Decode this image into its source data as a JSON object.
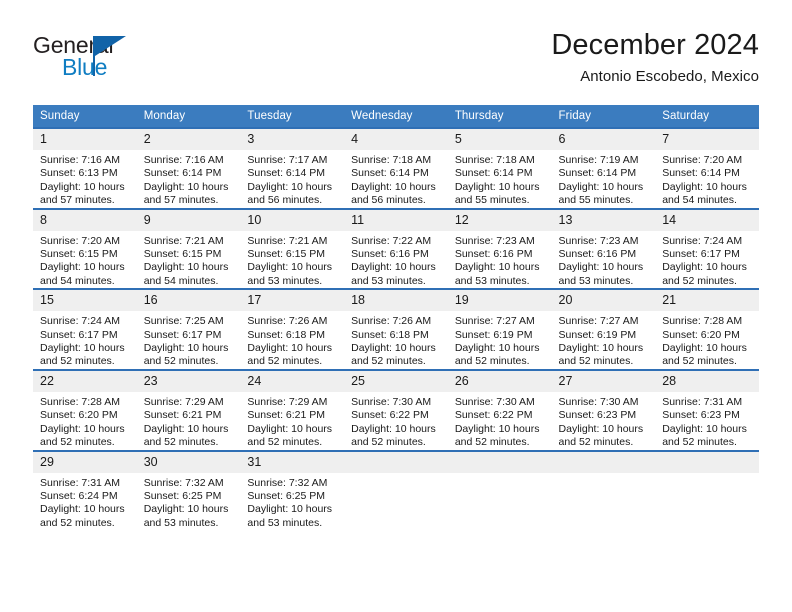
{
  "logo": {
    "word_top": "General",
    "word_bottom": "Blue",
    "accent_color": "#1163a8",
    "text_color": "#231f20"
  },
  "header": {
    "title": "December 2024",
    "subtitle": "Antonio Escobedo, Mexico"
  },
  "colors": {
    "header_row_bg": "#3b7cbf",
    "row_border": "#2f6fb5",
    "daynum_bg": "#efefef",
    "page_bg": "#ffffff",
    "text": "#1a1a1a"
  },
  "weekday_headers": [
    "Sunday",
    "Monday",
    "Tuesday",
    "Wednesday",
    "Thursday",
    "Friday",
    "Saturday"
  ],
  "labels": {
    "sunrise_prefix": "Sunrise:",
    "sunset_prefix": "Sunset:",
    "daylight_prefix": "Daylight:"
  },
  "weeks": [
    [
      {
        "day": "1",
        "sunrise": "Sunrise: 7:16 AM",
        "sunset": "Sunset: 6:13 PM",
        "daylight_1": "Daylight: 10 hours",
        "daylight_2": "and 57 minutes."
      },
      {
        "day": "2",
        "sunrise": "Sunrise: 7:16 AM",
        "sunset": "Sunset: 6:14 PM",
        "daylight_1": "Daylight: 10 hours",
        "daylight_2": "and 57 minutes."
      },
      {
        "day": "3",
        "sunrise": "Sunrise: 7:17 AM",
        "sunset": "Sunset: 6:14 PM",
        "daylight_1": "Daylight: 10 hours",
        "daylight_2": "and 56 minutes."
      },
      {
        "day": "4",
        "sunrise": "Sunrise: 7:18 AM",
        "sunset": "Sunset: 6:14 PM",
        "daylight_1": "Daylight: 10 hours",
        "daylight_2": "and 56 minutes."
      },
      {
        "day": "5",
        "sunrise": "Sunrise: 7:18 AM",
        "sunset": "Sunset: 6:14 PM",
        "daylight_1": "Daylight: 10 hours",
        "daylight_2": "and 55 minutes."
      },
      {
        "day": "6",
        "sunrise": "Sunrise: 7:19 AM",
        "sunset": "Sunset: 6:14 PM",
        "daylight_1": "Daylight: 10 hours",
        "daylight_2": "and 55 minutes."
      },
      {
        "day": "7",
        "sunrise": "Sunrise: 7:20 AM",
        "sunset": "Sunset: 6:14 PM",
        "daylight_1": "Daylight: 10 hours",
        "daylight_2": "and 54 minutes."
      }
    ],
    [
      {
        "day": "8",
        "sunrise": "Sunrise: 7:20 AM",
        "sunset": "Sunset: 6:15 PM",
        "daylight_1": "Daylight: 10 hours",
        "daylight_2": "and 54 minutes."
      },
      {
        "day": "9",
        "sunrise": "Sunrise: 7:21 AM",
        "sunset": "Sunset: 6:15 PM",
        "daylight_1": "Daylight: 10 hours",
        "daylight_2": "and 54 minutes."
      },
      {
        "day": "10",
        "sunrise": "Sunrise: 7:21 AM",
        "sunset": "Sunset: 6:15 PM",
        "daylight_1": "Daylight: 10 hours",
        "daylight_2": "and 53 minutes."
      },
      {
        "day": "11",
        "sunrise": "Sunrise: 7:22 AM",
        "sunset": "Sunset: 6:16 PM",
        "daylight_1": "Daylight: 10 hours",
        "daylight_2": "and 53 minutes."
      },
      {
        "day": "12",
        "sunrise": "Sunrise: 7:23 AM",
        "sunset": "Sunset: 6:16 PM",
        "daylight_1": "Daylight: 10 hours",
        "daylight_2": "and 53 minutes."
      },
      {
        "day": "13",
        "sunrise": "Sunrise: 7:23 AM",
        "sunset": "Sunset: 6:16 PM",
        "daylight_1": "Daylight: 10 hours",
        "daylight_2": "and 53 minutes."
      },
      {
        "day": "14",
        "sunrise": "Sunrise: 7:24 AM",
        "sunset": "Sunset: 6:17 PM",
        "daylight_1": "Daylight: 10 hours",
        "daylight_2": "and 52 minutes."
      }
    ],
    [
      {
        "day": "15",
        "sunrise": "Sunrise: 7:24 AM",
        "sunset": "Sunset: 6:17 PM",
        "daylight_1": "Daylight: 10 hours",
        "daylight_2": "and 52 minutes."
      },
      {
        "day": "16",
        "sunrise": "Sunrise: 7:25 AM",
        "sunset": "Sunset: 6:17 PM",
        "daylight_1": "Daylight: 10 hours",
        "daylight_2": "and 52 minutes."
      },
      {
        "day": "17",
        "sunrise": "Sunrise: 7:26 AM",
        "sunset": "Sunset: 6:18 PM",
        "daylight_1": "Daylight: 10 hours",
        "daylight_2": "and 52 minutes."
      },
      {
        "day": "18",
        "sunrise": "Sunrise: 7:26 AM",
        "sunset": "Sunset: 6:18 PM",
        "daylight_1": "Daylight: 10 hours",
        "daylight_2": "and 52 minutes."
      },
      {
        "day": "19",
        "sunrise": "Sunrise: 7:27 AM",
        "sunset": "Sunset: 6:19 PM",
        "daylight_1": "Daylight: 10 hours",
        "daylight_2": "and 52 minutes."
      },
      {
        "day": "20",
        "sunrise": "Sunrise: 7:27 AM",
        "sunset": "Sunset: 6:19 PM",
        "daylight_1": "Daylight: 10 hours",
        "daylight_2": "and 52 minutes."
      },
      {
        "day": "21",
        "sunrise": "Sunrise: 7:28 AM",
        "sunset": "Sunset: 6:20 PM",
        "daylight_1": "Daylight: 10 hours",
        "daylight_2": "and 52 minutes."
      }
    ],
    [
      {
        "day": "22",
        "sunrise": "Sunrise: 7:28 AM",
        "sunset": "Sunset: 6:20 PM",
        "daylight_1": "Daylight: 10 hours",
        "daylight_2": "and 52 minutes."
      },
      {
        "day": "23",
        "sunrise": "Sunrise: 7:29 AM",
        "sunset": "Sunset: 6:21 PM",
        "daylight_1": "Daylight: 10 hours",
        "daylight_2": "and 52 minutes."
      },
      {
        "day": "24",
        "sunrise": "Sunrise: 7:29 AM",
        "sunset": "Sunset: 6:21 PM",
        "daylight_1": "Daylight: 10 hours",
        "daylight_2": "and 52 minutes."
      },
      {
        "day": "25",
        "sunrise": "Sunrise: 7:30 AM",
        "sunset": "Sunset: 6:22 PM",
        "daylight_1": "Daylight: 10 hours",
        "daylight_2": "and 52 minutes."
      },
      {
        "day": "26",
        "sunrise": "Sunrise: 7:30 AM",
        "sunset": "Sunset: 6:22 PM",
        "daylight_1": "Daylight: 10 hours",
        "daylight_2": "and 52 minutes."
      },
      {
        "day": "27",
        "sunrise": "Sunrise: 7:30 AM",
        "sunset": "Sunset: 6:23 PM",
        "daylight_1": "Daylight: 10 hours",
        "daylight_2": "and 52 minutes."
      },
      {
        "day": "28",
        "sunrise": "Sunrise: 7:31 AM",
        "sunset": "Sunset: 6:23 PM",
        "daylight_1": "Daylight: 10 hours",
        "daylight_2": "and 52 minutes."
      }
    ],
    [
      {
        "day": "29",
        "sunrise": "Sunrise: 7:31 AM",
        "sunset": "Sunset: 6:24 PM",
        "daylight_1": "Daylight: 10 hours",
        "daylight_2": "and 52 minutes."
      },
      {
        "day": "30",
        "sunrise": "Sunrise: 7:32 AM",
        "sunset": "Sunset: 6:25 PM",
        "daylight_1": "Daylight: 10 hours",
        "daylight_2": "and 53 minutes."
      },
      {
        "day": "31",
        "sunrise": "Sunrise: 7:32 AM",
        "sunset": "Sunset: 6:25 PM",
        "daylight_1": "Daylight: 10 hours",
        "daylight_2": "and 53 minutes."
      },
      {
        "day": "",
        "sunrise": "",
        "sunset": "",
        "daylight_1": "",
        "daylight_2": ""
      },
      {
        "day": "",
        "sunrise": "",
        "sunset": "",
        "daylight_1": "",
        "daylight_2": ""
      },
      {
        "day": "",
        "sunrise": "",
        "sunset": "",
        "daylight_1": "",
        "daylight_2": ""
      },
      {
        "day": "",
        "sunrise": "",
        "sunset": "",
        "daylight_1": "",
        "daylight_2": ""
      }
    ]
  ]
}
